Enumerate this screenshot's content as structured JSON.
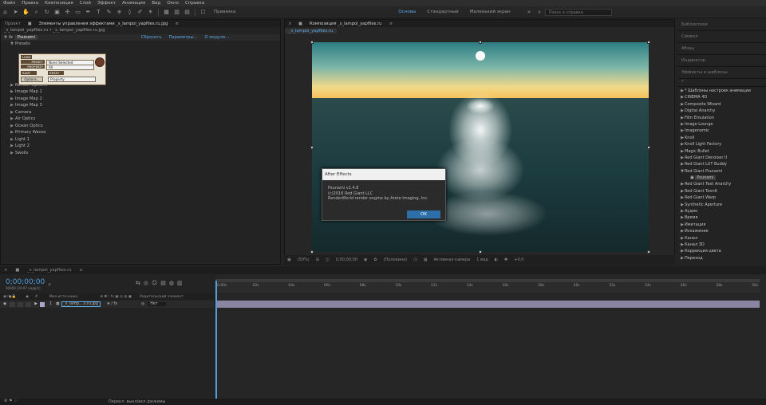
{
  "menu": [
    "Файл",
    "Правка",
    "Композиция",
    "Слой",
    "Эффект",
    "Анимация",
    "Вид",
    "Окно",
    "Справка"
  ],
  "toolbar": {
    "snap_label": "Привязка",
    "workspaces": [
      {
        "label": "Основы",
        "active": true
      },
      {
        "label": "Стандартный",
        "active": false
      },
      {
        "label": "Маленький экран",
        "active": false
      }
    ],
    "search_placeholder": "Поиск в справке"
  },
  "left_panel": {
    "tabs": [
      "Проект",
      "Элементы управления эффектами _s_lampoi_yapfiles.ru.jpg"
    ],
    "breadcrumb": "_s_lampoi_yapfiles.ru • _s_lampoi_yapfiles.ru.jpg",
    "fx_name": "Psunami",
    "fx_links": [
      "Сбросить",
      "Параметры...",
      "О модуле..."
    ],
    "presets_label": "Presets",
    "ps_ui": {
      "load": "LOAD",
      "preset_lbl": "PRESET",
      "preset_val": "None Selected",
      "property_lbl": "PROPERTY",
      "property_val": "All",
      "save": "SAVE",
      "options": "Options...",
      "reset": "RESET",
      "reset_val": "Property"
    },
    "groups": [
      "Render Options",
      "Image Map 1",
      "Image Map 2",
      "Image Map 3",
      "Camera",
      "Air Optics",
      "Ocean Optics",
      "Primary Waves",
      "Light 1",
      "Light 2",
      "Swells"
    ]
  },
  "comp_panel": {
    "tab": "Композиция _s_lampoi_yapfiles.ru",
    "subtab": "_s_lampoi_yapfiles.ru",
    "footer": {
      "zoom": "(50%)",
      "time": "0;00;00;00",
      "resolution": "(Половина)",
      "camera": "Активная камера",
      "views": "1 вид",
      "exposure": "+0,0"
    }
  },
  "dialog": {
    "title": "After Effects",
    "lines": [
      "Psunami v1.4.8",
      "(c)2016 Red Giant LLC",
      "RenderWorld render engine by Arete Imaging, Inc."
    ],
    "ok": "OK"
  },
  "right_panel": {
    "sections": [
      "Библиотеки",
      "Символ",
      "Абзац",
      "Индикатор",
      "Эффекты и шаблоны"
    ],
    "fx_items": [
      {
        "label": "* Шаблоны настроек анимации",
        "open": false
      },
      {
        "label": "CINEMA 4D",
        "open": false
      },
      {
        "label": "Composite Wizard",
        "open": false
      },
      {
        "label": "Digital Anarchy",
        "open": false
      },
      {
        "label": "Film Emulation",
        "open": false
      },
      {
        "label": "Image Lounge",
        "open": false
      },
      {
        "label": "Imagenomic",
        "open": false
      },
      {
        "label": "Knoll",
        "open": false
      },
      {
        "label": "Knoll Light Factory",
        "open": false
      },
      {
        "label": "Magic Bullet",
        "open": false
      },
      {
        "label": "Red Giant Denoiser II",
        "open": false
      },
      {
        "label": "Red Giant LUT Buddy",
        "open": false
      },
      {
        "label": "Red Giant Psunami",
        "open": true
      },
      {
        "label": "Psunami",
        "child": true
      },
      {
        "label": "Red Giant Text Anarchy",
        "open": false
      },
      {
        "label": "Red Giant ToonIt",
        "open": false
      },
      {
        "label": "Red Giant Warp",
        "open": false
      },
      {
        "label": "Synthetic Aperture",
        "open": false
      },
      {
        "label": "Аудио",
        "open": false
      },
      {
        "label": "Время",
        "open": false
      },
      {
        "label": "Имитация",
        "open": false
      },
      {
        "label": "Искажение",
        "open": false
      },
      {
        "label": "Канал",
        "open": false
      },
      {
        "label": "Канал 3D",
        "open": false
      },
      {
        "label": "Коррекция цвета",
        "open": false
      },
      {
        "label": "Переход",
        "open": false
      }
    ]
  },
  "timeline": {
    "tab": "_s_lampoi_yapfiles.ru",
    "timecode": "0;00;00;00",
    "fps": "00000 (29.97 кадр/с)",
    "col_source": "Имя источника",
    "col_parent": "Родительский элемент",
    "layer_num": "1",
    "layer_name": "_s_lamp....s.ru.jpg",
    "layer_parent": "Нет",
    "ruler": [
      "0:00s",
      "02s",
      "04s",
      "06s",
      "08s",
      "10s",
      "12s",
      "14s",
      "16s",
      "18s",
      "20s",
      "22s",
      "24s",
      "26s",
      "28s",
      "30s"
    ],
    "status": "Перекл. выкл/вкл./режимы"
  },
  "colors": {
    "accent": "#5aa7e6",
    "ok_button": "#2d6fa8",
    "layer_bar": "#8a86a4"
  }
}
